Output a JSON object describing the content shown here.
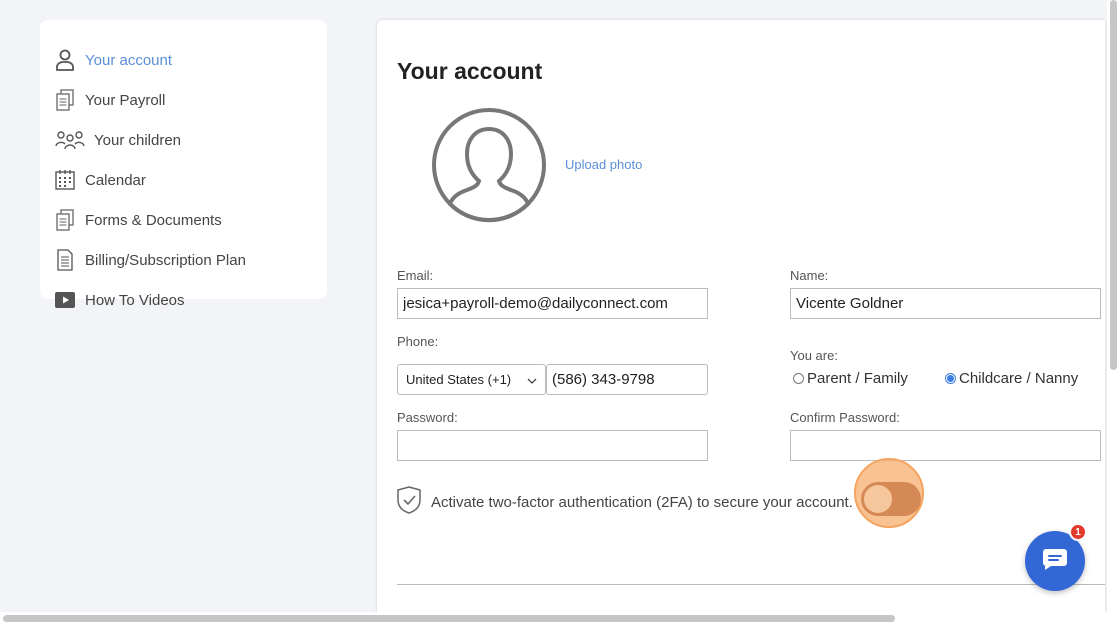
{
  "sidebar": {
    "items": [
      {
        "label": "Your account",
        "icon": "user-icon",
        "active": true
      },
      {
        "label": "Your Payroll",
        "icon": "documents-icon"
      },
      {
        "label": "Your children",
        "icon": "people-group-icon"
      },
      {
        "label": "Calendar",
        "icon": "calendar-icon"
      },
      {
        "label": "Forms & Documents",
        "icon": "documents-icon"
      },
      {
        "label": "Billing/Subscription Plan",
        "icon": "document-icon"
      },
      {
        "label": "How To Videos",
        "icon": "play-video-icon"
      }
    ]
  },
  "main": {
    "title": "Your account",
    "upload_photo": "Upload photo",
    "email": {
      "label": "Email:",
      "value": "jesica+payroll-demo@dailyconnect.com"
    },
    "name": {
      "label": "Name:",
      "value": "Vicente Goldner"
    },
    "phone": {
      "label": "Phone:",
      "country": "United States (+1)",
      "value": "(586) 343-9798"
    },
    "role": {
      "label": "You are:",
      "options": [
        {
          "label": "Parent / Family",
          "selected": false
        },
        {
          "label": "Childcare / Nanny",
          "selected": true
        }
      ]
    },
    "password": {
      "label": "Password:",
      "value": ""
    },
    "confirm_password": {
      "label": "Confirm Password:",
      "value": ""
    },
    "two_factor": {
      "text": "Activate two-factor authentication (2FA) to secure your account.",
      "enabled": false
    }
  },
  "chat": {
    "badge_count": "1"
  },
  "colors": {
    "accent": "#5b8fd6",
    "chat_button": "#3467d6",
    "badge": "#e23b2d",
    "highlight": "#f5a35e"
  }
}
